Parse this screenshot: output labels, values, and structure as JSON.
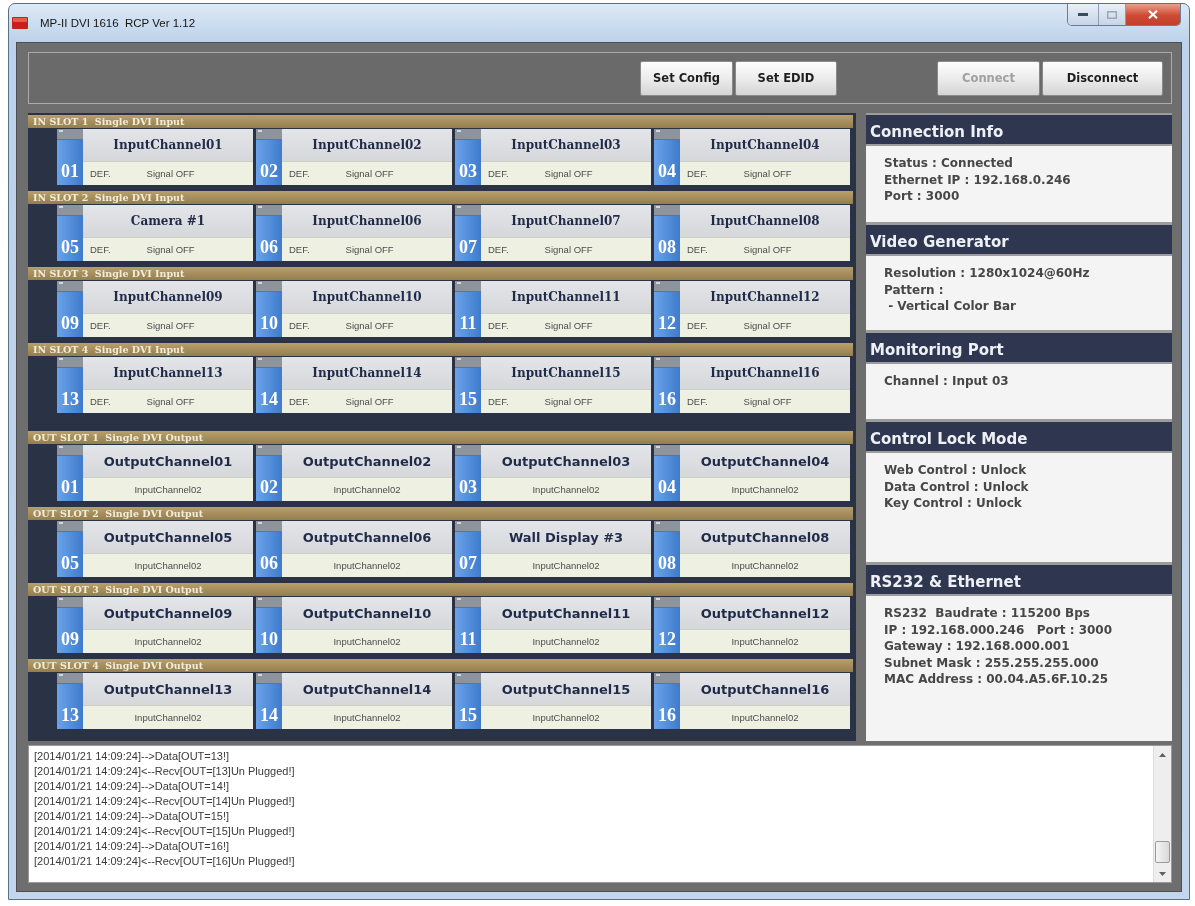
{
  "window": {
    "title": "MP-II DVI 1616  RCP Ver 1.12"
  },
  "toolbar": {
    "left_buttons": [
      {
        "label": "Set Config",
        "disabled": false
      },
      {
        "label": "Set EDID",
        "disabled": false
      }
    ],
    "right_buttons": [
      {
        "label": "Connect",
        "disabled": true
      },
      {
        "label": "Disconnect",
        "disabled": false
      }
    ]
  },
  "input_slots": [
    {
      "title": "IN SLOT 1  Single DVI Input",
      "channels": [
        {
          "number": "01",
          "name": "InputChannel01",
          "edid": "DEF.",
          "signal": "Signal OFF"
        },
        {
          "number": "02",
          "name": "InputChannel02",
          "edid": "DEF.",
          "signal": "Signal OFF"
        },
        {
          "number": "03",
          "name": "InputChannel03",
          "edid": "DEF.",
          "signal": "Signal OFF"
        },
        {
          "number": "04",
          "name": "InputChannel04",
          "edid": "DEF.",
          "signal": "Signal OFF"
        }
      ]
    },
    {
      "title": "IN SLOT 2  Single DVI Input",
      "channels": [
        {
          "number": "05",
          "name": "Camera #1",
          "edid": "DEF.",
          "signal": "Signal OFF"
        },
        {
          "number": "06",
          "name": "InputChannel06",
          "edid": "DEF.",
          "signal": "Signal OFF"
        },
        {
          "number": "07",
          "name": "InputChannel07",
          "edid": "DEF.",
          "signal": "Signal OFF"
        },
        {
          "number": "08",
          "name": "InputChannel08",
          "edid": "DEF.",
          "signal": "Signal OFF"
        }
      ]
    },
    {
      "title": "IN SLOT 3  Single DVI Input",
      "channels": [
        {
          "number": "09",
          "name": "InputChannel09",
          "edid": "DEF.",
          "signal": "Signal OFF"
        },
        {
          "number": "10",
          "name": "InputChannel10",
          "edid": "DEF.",
          "signal": "Signal OFF"
        },
        {
          "number": "11",
          "name": "InputChannel11",
          "edid": "DEF.",
          "signal": "Signal OFF"
        },
        {
          "number": "12",
          "name": "InputChannel12",
          "edid": "DEF.",
          "signal": "Signal OFF"
        }
      ]
    },
    {
      "title": "IN SLOT 4  Single DVI Input",
      "channels": [
        {
          "number": "13",
          "name": "InputChannel13",
          "edid": "DEF.",
          "signal": "Signal OFF"
        },
        {
          "number": "14",
          "name": "InputChannel14",
          "edid": "DEF.",
          "signal": "Signal OFF"
        },
        {
          "number": "15",
          "name": "InputChannel15",
          "edid": "DEF.",
          "signal": "Signal OFF"
        },
        {
          "number": "16",
          "name": "InputChannel16",
          "edid": "DEF.",
          "signal": "Signal OFF"
        }
      ]
    }
  ],
  "output_slots": [
    {
      "title": "OUT SLOT 1  Single DVI Output",
      "channels": [
        {
          "number": "01",
          "name": "OutputChannel01",
          "source": "InputChannel02"
        },
        {
          "number": "02",
          "name": "OutputChannel02",
          "source": "InputChannel02"
        },
        {
          "number": "03",
          "name": "OutputChannel03",
          "source": "InputChannel02"
        },
        {
          "number": "04",
          "name": "OutputChannel04",
          "source": "InputChannel02"
        }
      ]
    },
    {
      "title": "OUT SLOT 2  Single DVI Output",
      "channels": [
        {
          "number": "05",
          "name": "OutputChannel05",
          "source": "InputChannel02"
        },
        {
          "number": "06",
          "name": "OutputChannel06",
          "source": "InputChannel02"
        },
        {
          "number": "07",
          "name": "Wall Display #3",
          "source": "InputChannel02"
        },
        {
          "number": "08",
          "name": "OutputChannel08",
          "source": "InputChannel02"
        }
      ]
    },
    {
      "title": "OUT SLOT 3  Single DVI Output",
      "channels": [
        {
          "number": "09",
          "name": "OutputChannel09",
          "source": "InputChannel02"
        },
        {
          "number": "10",
          "name": "OutputChannel10",
          "source": "InputChannel02"
        },
        {
          "number": "11",
          "name": "OutputChannel11",
          "source": "InputChannel02"
        },
        {
          "number": "12",
          "name": "OutputChannel12",
          "source": "InputChannel02"
        }
      ]
    },
    {
      "title": "OUT SLOT 4  Single DVI Output",
      "channels": [
        {
          "number": "13",
          "name": "OutputChannel13",
          "source": "InputChannel02"
        },
        {
          "number": "14",
          "name": "OutputChannel14",
          "source": "InputChannel02"
        },
        {
          "number": "15",
          "name": "OutputChannel15",
          "source": "InputChannel02"
        },
        {
          "number": "16",
          "name": "OutputChannel16",
          "source": "InputChannel02"
        }
      ]
    }
  ],
  "info_panels": [
    {
      "title": "Connection Info",
      "lines": [
        "Status : Connected",
        "Ethernet IP : 192.168.0.246",
        "Port : 3000"
      ]
    },
    {
      "title": "Video Generator",
      "lines": [
        "Resolution : 1280x1024@60Hz",
        "Pattern :",
        " - Vertical Color Bar"
      ]
    },
    {
      "title": "Monitoring Port",
      "lines": [
        "Channel : Input 03"
      ]
    },
    {
      "title": "Control Lock Mode",
      "lines": [
        "Web Control : Unlock",
        "Data Control : Unlock",
        "Key Control : Unlock"
      ]
    },
    {
      "title": "RS232 & Ethernet",
      "lines": [
        "RS232  Baudrate : 115200 Bps",
        "IP : 192.168.000.246   Port : 3000",
        "Gateway : 192.168.000.001",
        "Subnet Mask : 255.255.255.000",
        "MAC Address : 00.04.A5.6F.10.25"
      ]
    }
  ],
  "log": {
    "lines": [
      "[2014/01/21 14:09:24]-->Data[OUT=13!]",
      "[2014/01/21 14:09:24]<--Recv[OUT=[13]Un Plugged!]",
      "[2014/01/21 14:09:24]-->Data[OUT=14!]",
      "[2014/01/21 14:09:24]<--Recv[OUT=[14]Un Plugged!]",
      "[2014/01/21 14:09:24]-->Data[OUT=15!]",
      "[2014/01/21 14:09:24]<--Recv[OUT=[15]Un Plugged!]",
      "[2014/01/21 14:09:24]-->Data[OUT=16!]",
      "[2014/01/21 14:09:24]<--Recv[OUT=[16]Un Plugged!]"
    ]
  }
}
